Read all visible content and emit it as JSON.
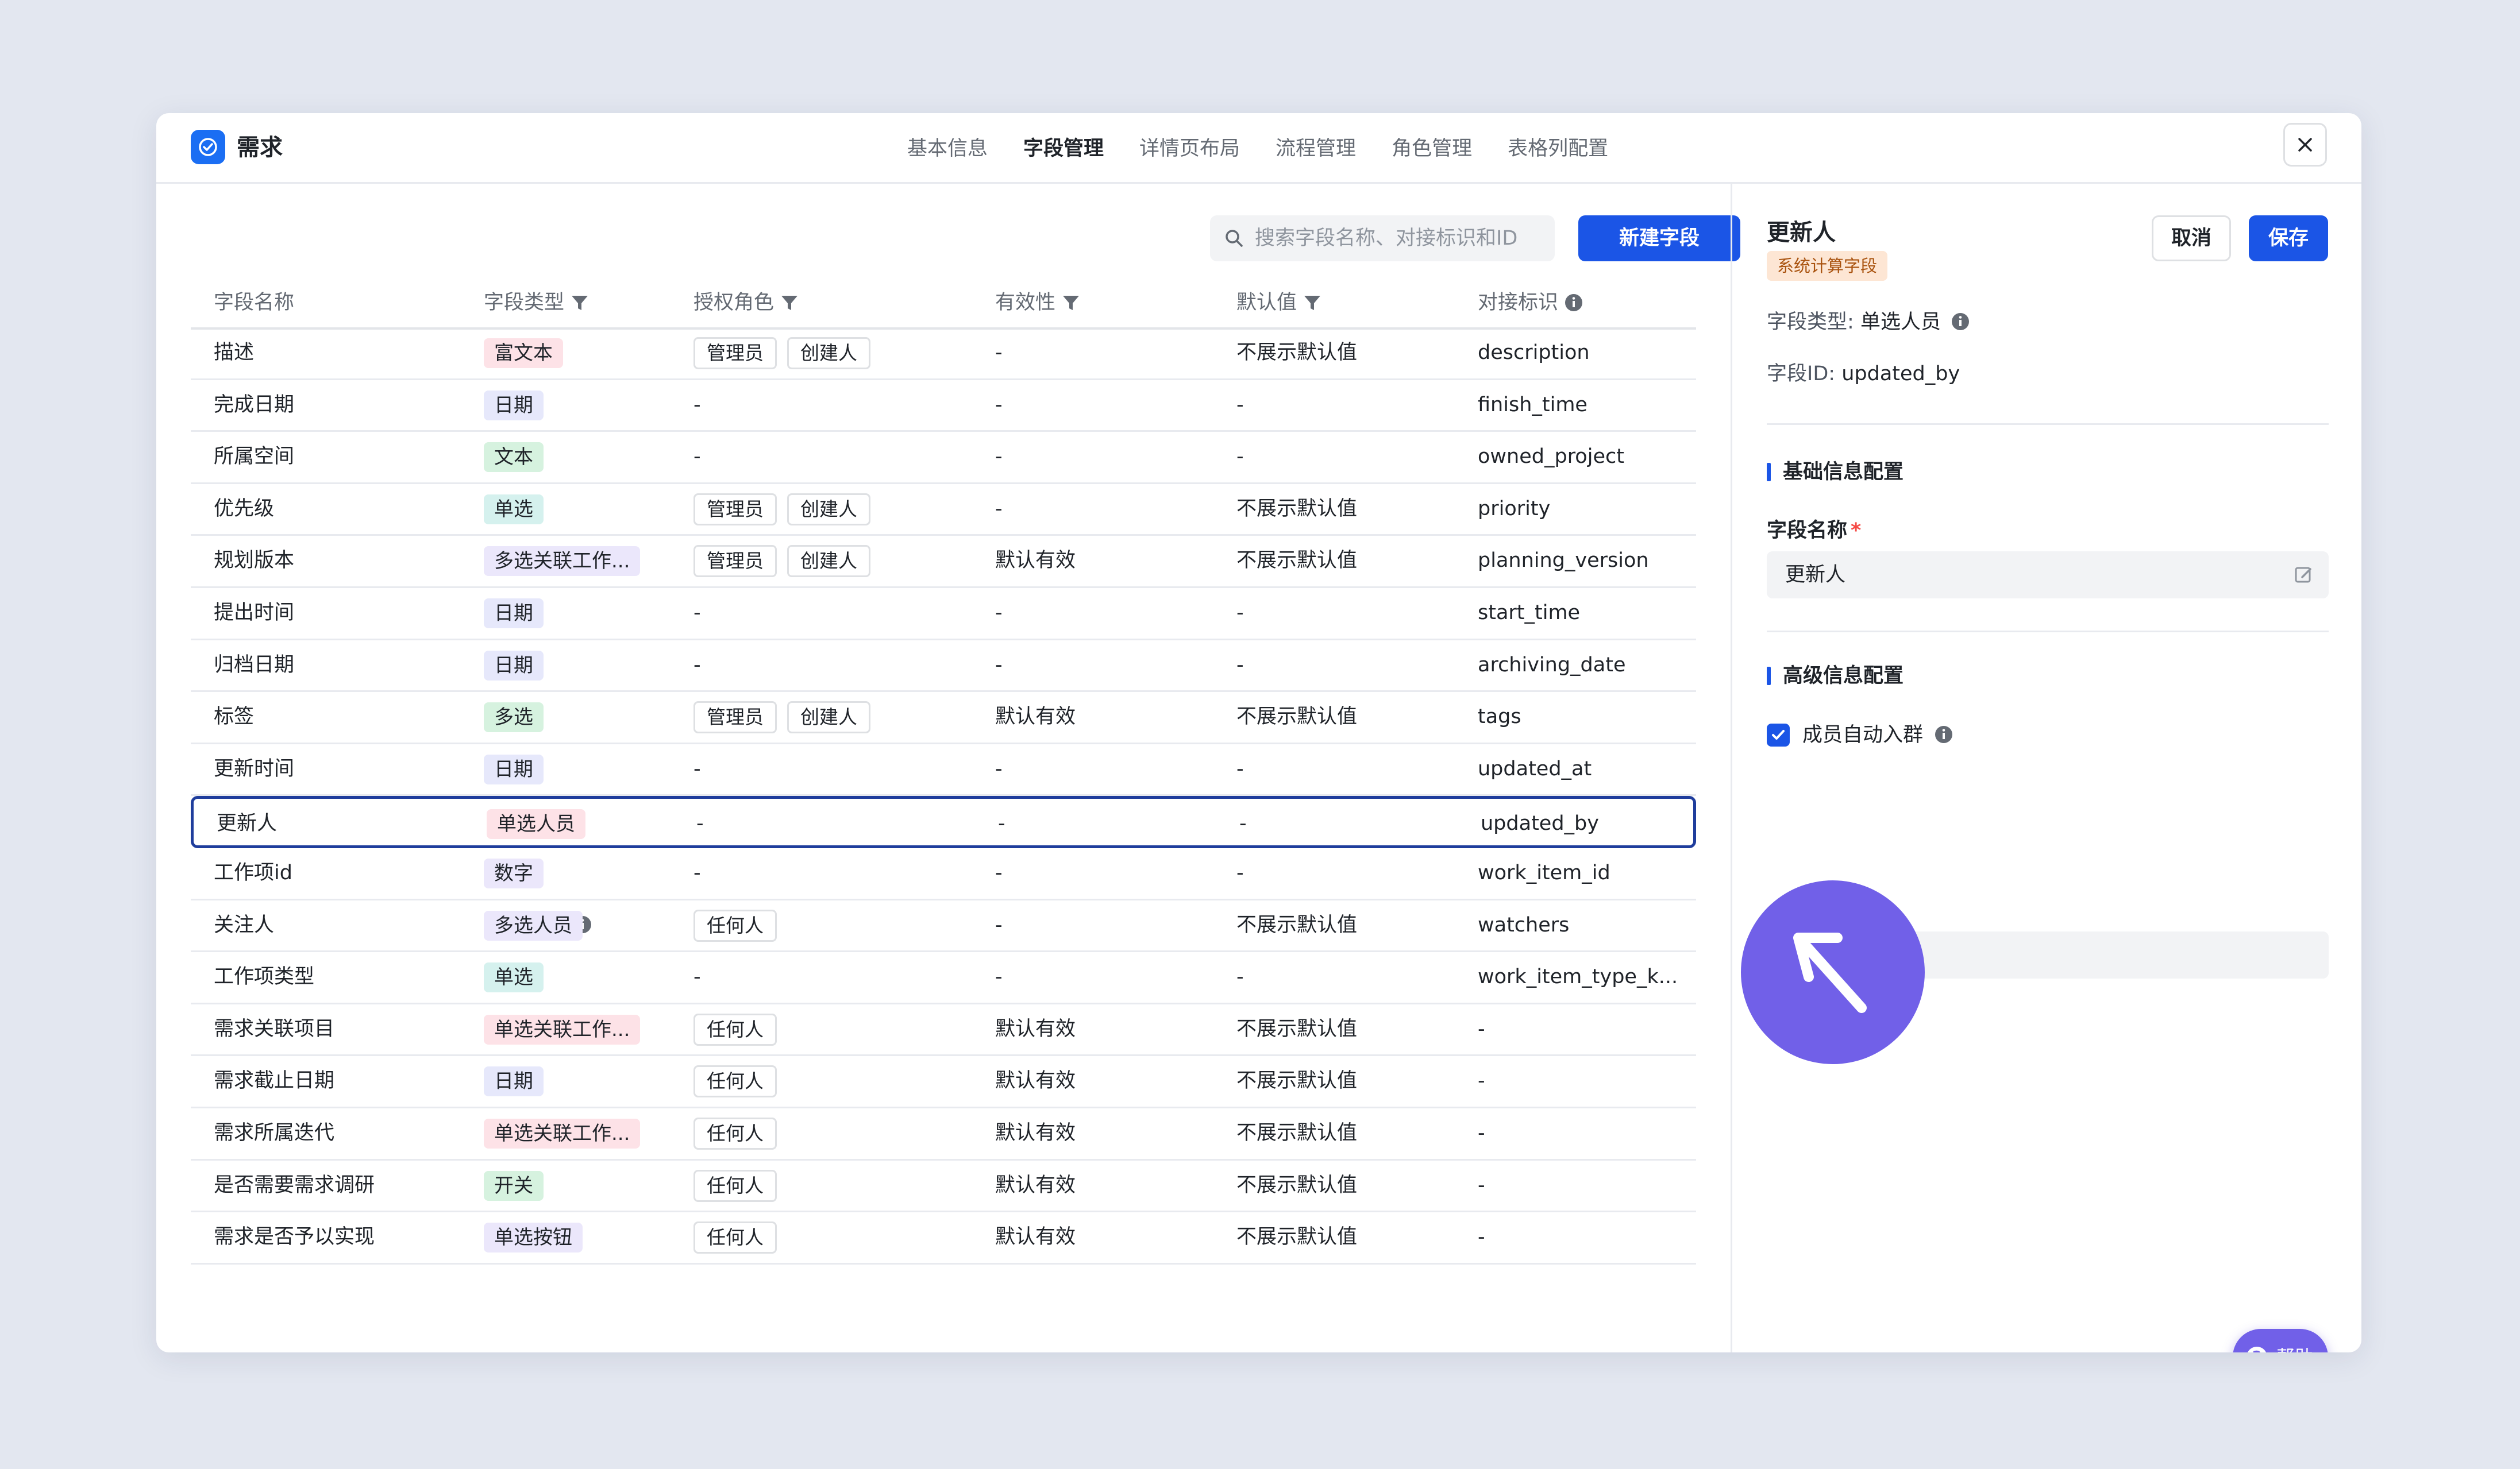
{
  "app": {
    "title": "需求"
  },
  "tabs": [
    {
      "label": "基本信息",
      "active": false
    },
    {
      "label": "字段管理",
      "active": true
    },
    {
      "label": "详情页布局",
      "active": false
    },
    {
      "label": "流程管理",
      "active": false
    },
    {
      "label": "角色管理",
      "active": false
    },
    {
      "label": "表格列配置",
      "active": false
    }
  ],
  "toolbar": {
    "search_placeholder": "搜索字段名称、对接标识和ID",
    "new_field_label": "新建字段"
  },
  "table": {
    "columns": [
      "字段名称",
      "字段类型",
      "授权角色",
      "有效性",
      "默认值",
      "对接标识"
    ],
    "rows": [
      {
        "name": "描述",
        "type": "富文本",
        "type_color": "pink",
        "roles": [
          "管理员",
          "创建人"
        ],
        "validity": "-",
        "default": "不展示默认值",
        "key": "description"
      },
      {
        "name": "完成日期",
        "type": "日期",
        "type_color": "purple",
        "roles": [],
        "role_text": "-",
        "validity": "-",
        "default": "-",
        "key": "finish_time"
      },
      {
        "name": "所属空间",
        "type": "文本",
        "type_color": "green",
        "roles": [],
        "role_text": "-",
        "validity": "-",
        "default": "-",
        "key": "owned_project"
      },
      {
        "name": "优先级",
        "type": "单选",
        "type_color": "teal",
        "roles": [
          "管理员",
          "创建人"
        ],
        "validity": "-",
        "default": "不展示默认值",
        "key": "priority"
      },
      {
        "name": "规划版本",
        "type": "多选关联工作...",
        "type_color": "lavender",
        "roles": [
          "管理员",
          "创建人"
        ],
        "validity": "默认有效",
        "default": "不展示默认值",
        "key": "planning_version"
      },
      {
        "name": "提出时间",
        "type": "日期",
        "type_color": "purple",
        "roles": [],
        "role_text": "-",
        "validity": "-",
        "default": "-",
        "key": "start_time"
      },
      {
        "name": "归档日期",
        "type": "日期",
        "type_color": "purple",
        "roles": [],
        "role_text": "-",
        "validity": "-",
        "default": "-",
        "key": "archiving_date"
      },
      {
        "name": "标签",
        "type": "多选",
        "type_color": "green",
        "roles": [
          "管理员",
          "创建人"
        ],
        "validity": "默认有效",
        "default": "不展示默认值",
        "key": "tags"
      },
      {
        "name": "更新时间",
        "type": "日期",
        "type_color": "purple",
        "roles": [],
        "role_text": "-",
        "validity": "-",
        "default": "-",
        "key": "updated_at"
      },
      {
        "name": "更新人",
        "type": "单选人员",
        "type_color": "pink",
        "roles": [],
        "role_text": "-",
        "validity": "-",
        "default": "-",
        "key": "updated_by",
        "selected": true
      },
      {
        "name": "工作项id",
        "type": "数字",
        "type_color": "lavender",
        "roles": [],
        "role_text": "-",
        "validity": "-",
        "default": "-",
        "key": "work_item_id"
      },
      {
        "name": "关注人",
        "type": "多选人员",
        "type_color": "lavender",
        "roles": [
          "任何人"
        ],
        "validity": "-",
        "default": "不展示默认值",
        "key": "watchers",
        "info": true
      },
      {
        "name": "工作项类型",
        "type": "单选",
        "type_color": "teal",
        "roles": [],
        "role_text": "-",
        "validity": "-",
        "default": "-",
        "key": "work_item_type_k..."
      },
      {
        "name": "需求关联项目",
        "type": "单选关联工作...",
        "type_color": "pink",
        "roles": [
          "任何人"
        ],
        "validity": "默认有效",
        "default": "不展示默认值",
        "key": "-"
      },
      {
        "name": "需求截止日期",
        "type": "日期",
        "type_color": "purple",
        "roles": [
          "任何人"
        ],
        "validity": "默认有效",
        "default": "不展示默认值",
        "key": "-"
      },
      {
        "name": "需求所属迭代",
        "type": "单选关联工作...",
        "type_color": "pink",
        "roles": [
          "任何人"
        ],
        "validity": "默认有效",
        "default": "不展示默认值",
        "key": "-"
      },
      {
        "name": "是否需要需求调研",
        "type": "开关",
        "type_color": "green",
        "roles": [
          "任何人"
        ],
        "validity": "默认有效",
        "default": "不展示默认值",
        "key": "-"
      },
      {
        "name": "需求是否予以实现",
        "type": "单选按钮",
        "type_color": "lavender",
        "roles": [
          "任何人"
        ],
        "validity": "默认有效",
        "default": "不展示默认值",
        "key": "-"
      }
    ]
  },
  "tag_colors": {
    "pink": {
      "bg": "#fde2e7",
      "fg": "#1f2329"
    },
    "purple": {
      "bg": "#e6e8fb",
      "fg": "#1f2329"
    },
    "green": {
      "bg": "#d6f2df",
      "fg": "#1f2329"
    },
    "teal": {
      "bg": "#d5f1ee",
      "fg": "#1f2329"
    },
    "lavender": {
      "bg": "#ebe7fb",
      "fg": "#1f2329"
    }
  },
  "panel": {
    "title": "更新人",
    "badge": "系统计算字段",
    "cancel_label": "取消",
    "save_label": "保存",
    "type_key": "字段类型:",
    "type_value": "单选人员",
    "id_key": "字段ID:",
    "id_value": "updated_by",
    "basic_section": "基础信息配置",
    "name_label": "字段名称",
    "required_mark": "*",
    "name_value": "更新人",
    "advanced_section": "高级信息配置",
    "auto_join_label": "成员自动入群",
    "auto_join_checked": true,
    "help_label": "帮助"
  }
}
